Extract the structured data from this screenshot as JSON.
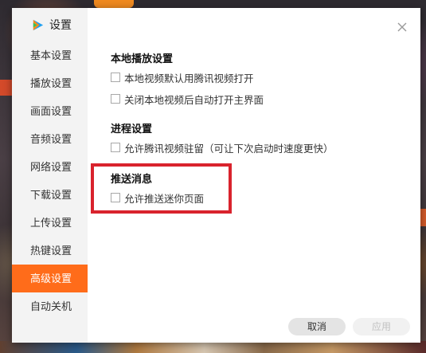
{
  "app": {
    "title": "设置",
    "icons": {
      "logo": "tencent-video-logo",
      "close": "close-icon"
    }
  },
  "sidebar": {
    "items": [
      {
        "label": "基本设置",
        "active": false
      },
      {
        "label": "播放设置",
        "active": false
      },
      {
        "label": "画面设置",
        "active": false
      },
      {
        "label": "音频设置",
        "active": false
      },
      {
        "label": "网络设置",
        "active": false
      },
      {
        "label": "下载设置",
        "active": false
      },
      {
        "label": "上传设置",
        "active": false
      },
      {
        "label": "热键设置",
        "active": false
      },
      {
        "label": "高级设置",
        "active": true
      },
      {
        "label": "自动关机",
        "active": false
      }
    ]
  },
  "sections": {
    "local_playback": {
      "title": "本地播放设置",
      "options": [
        {
          "label": "本地视频默认用腾讯视频打开",
          "checked": false
        },
        {
          "label": "关闭本地视频后自动打开主界面",
          "checked": false
        }
      ]
    },
    "process": {
      "title": "进程设置",
      "options": [
        {
          "label": "允许腾讯视频驻留（可让下次启动时速度更快）",
          "checked": false
        }
      ]
    },
    "push": {
      "title": "推送消息",
      "options": [
        {
          "label": "允许推送迷你页面",
          "checked": false
        }
      ]
    }
  },
  "footer": {
    "cancel_label": "取消",
    "apply_label": "应用",
    "apply_enabled": false
  },
  "colors": {
    "accent": "#ff6c1a",
    "highlight": "#d9232d"
  }
}
